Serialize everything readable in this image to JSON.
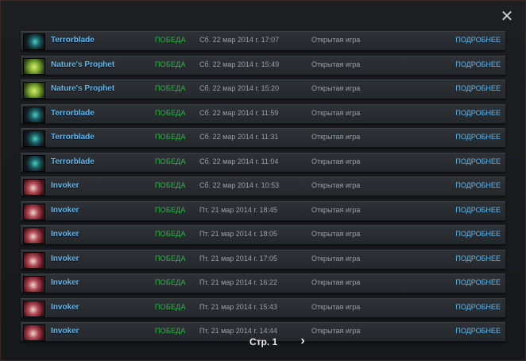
{
  "close_label": "✕",
  "colors": {
    "hero_name": "#5eb8f0",
    "result_win": "#2fb34a",
    "muted_text": "#9aa0a6",
    "details_link": "#5eb8f0"
  },
  "matches": [
    {
      "hero": "Terrorblade",
      "icon": "terrorblade",
      "result": "ПОБЕДА",
      "date": "Сб. 22 мар 2014 г. 17:07",
      "mode": "Открытая игра",
      "details": "ПОДРОБНЕЕ"
    },
    {
      "hero": "Nature's Prophet",
      "icon": "prophet",
      "result": "ПОБЕДА",
      "date": "Сб. 22 мар 2014 г. 15:49",
      "mode": "Открытая игра",
      "details": "ПОДРОБНЕЕ"
    },
    {
      "hero": "Nature's Prophet",
      "icon": "prophet",
      "result": "ПОБЕДА",
      "date": "Сб. 22 мар 2014 г. 15:20",
      "mode": "Открытая игра",
      "details": "ПОДРОБНЕЕ"
    },
    {
      "hero": "Terrorblade",
      "icon": "terrorblade",
      "result": "ПОБЕДА",
      "date": "Сб. 22 мар 2014 г. 11:59",
      "mode": "Открытая игра",
      "details": "ПОДРОБНЕЕ"
    },
    {
      "hero": "Terrorblade",
      "icon": "terrorblade",
      "result": "ПОБЕДА",
      "date": "Сб. 22 мар 2014 г. 11:31",
      "mode": "Открытая игра",
      "details": "ПОДРОБНЕЕ"
    },
    {
      "hero": "Terrorblade",
      "icon": "terrorblade",
      "result": "ПОБЕДА",
      "date": "Сб. 22 мар 2014 г. 11:04",
      "mode": "Открытая игра",
      "details": "ПОДРОБНЕЕ"
    },
    {
      "hero": "Invoker",
      "icon": "invoker",
      "result": "ПОБЕДА",
      "date": "Сб. 22 мар 2014 г. 10:53",
      "mode": "Открытая игра",
      "details": "ПОДРОБНЕЕ"
    },
    {
      "hero": "Invoker",
      "icon": "invoker",
      "result": "ПОБЕДА",
      "date": "Пт. 21 мар 2014 г. 18:45",
      "mode": "Открытая игра",
      "details": "ПОДРОБНЕЕ"
    },
    {
      "hero": "Invoker",
      "icon": "invoker",
      "result": "ПОБЕДА",
      "date": "Пт. 21 мар 2014 г. 18:05",
      "mode": "Открытая игра",
      "details": "ПОДРОБНЕЕ"
    },
    {
      "hero": "Invoker",
      "icon": "invoker",
      "result": "ПОБЕДА",
      "date": "Пт. 21 мар 2014 г. 17:05",
      "mode": "Открытая игра",
      "details": "ПОДРОБНЕЕ"
    },
    {
      "hero": "Invoker",
      "icon": "invoker",
      "result": "ПОБЕДА",
      "date": "Пт. 21 мар 2014 г. 16:22",
      "mode": "Открытая игра",
      "details": "ПОДРОБНЕЕ"
    },
    {
      "hero": "Invoker",
      "icon": "invoker",
      "result": "ПОБЕДА",
      "date": "Пт. 21 мар 2014 г. 15:43",
      "mode": "Открытая игра",
      "details": "ПОДРОБНЕЕ"
    },
    {
      "hero": "Invoker",
      "icon": "invoker",
      "result": "ПОБЕДА",
      "date": "Пт. 21 мар 2014 г. 14:44",
      "mode": "Открытая игра",
      "details": "ПОДРОБНЕЕ"
    }
  ],
  "pagination": {
    "page_label": "Стр. 1",
    "next_icon": "›"
  }
}
